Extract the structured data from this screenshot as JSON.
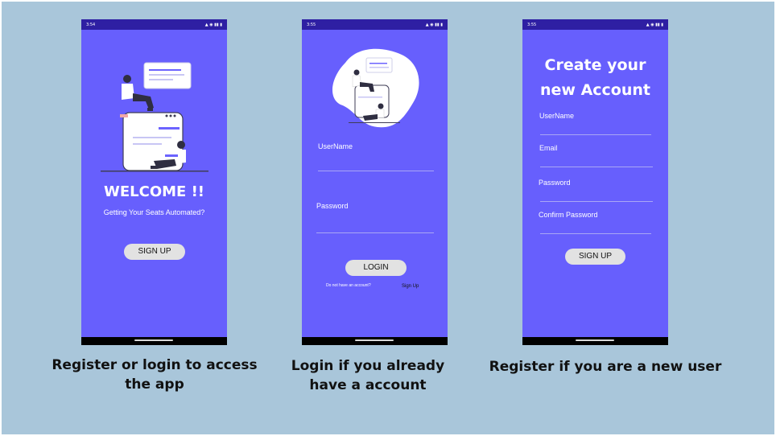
{
  "screens": {
    "welcome": {
      "status_time": "3:54",
      "title": "WELCOME !!",
      "subtitle": "Getting Your Seats Automated?",
      "signup_label": "SIGN UP"
    },
    "login": {
      "status_time": "3:55",
      "username_label": "UserName",
      "password_label": "Password",
      "login_label": "LOGIN",
      "no_account_text": "Do not have an account?",
      "signup_link": "Sign Up"
    },
    "register": {
      "status_time": "3:55",
      "title_line1": "Create your",
      "title_line2": "new Account",
      "username_label": "UserName",
      "email_label": "Email",
      "password_label": "Password",
      "confirm_password_label": "Confirm Password",
      "signup_label": "SIGN UP"
    }
  },
  "captions": {
    "welcome_line1": "Register or login to access",
    "welcome_line2": "the app",
    "login_line1": "Login if you already",
    "login_line2": "have a account",
    "register": "Register if you are a new user"
  },
  "colors": {
    "background": "#a9c6da",
    "phone_screen": "#675ffd",
    "status_bar": "#2e1fa3",
    "button": "#e2e2e2"
  },
  "icons": [
    "status-icons",
    "illustration-people-on-cards",
    "illustration-blob"
  ]
}
